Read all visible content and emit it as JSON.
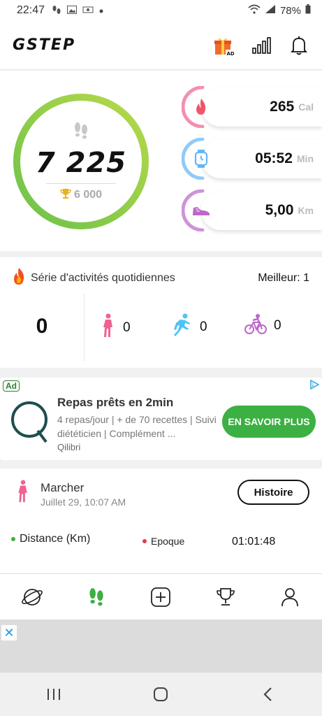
{
  "status_bar": {
    "time": "22:47",
    "battery": "78%"
  },
  "app": {
    "logo": "GSTEP"
  },
  "header_icons": [
    "gift-ad-icon",
    "bar-chart-icon",
    "bell-icon"
  ],
  "steps": {
    "count": "7 225",
    "goal": "6 000",
    "progress": 1.0
  },
  "metrics": [
    {
      "name": "calories",
      "value": "265",
      "unit": "Cal",
      "icon": "flame-icon",
      "color": "#f06292"
    },
    {
      "name": "duration",
      "value": "05:52",
      "unit": "Min",
      "icon": "watch-icon",
      "color": "#64b5f6"
    },
    {
      "name": "distance",
      "value": "5,00",
      "unit": "Km",
      "icon": "shoe-icon",
      "color": "#ba68c8"
    }
  ],
  "streak": {
    "title": "Série d'activités quotidiennes",
    "best": "Meilleur: 1",
    "total": "0",
    "activities": [
      {
        "icon": "walk-icon",
        "count": "0"
      },
      {
        "icon": "run-icon",
        "count": "0"
      },
      {
        "icon": "bike-icon",
        "count": "0"
      }
    ]
  },
  "ad": {
    "badge": "Ad",
    "title": "Repas prêts en 2min",
    "description": "4 repas/jour | + de 70 recettes | Suivi diététicien | Complément ...",
    "brand": "Qilibri",
    "cta": "EN SAVOIR PLUS"
  },
  "workout": {
    "type": "Marcher",
    "datetime": "Juillet 29, 10:07 AM",
    "history_button": "Histoire",
    "distance_label": "Distance (Km)",
    "epoch_label": "Epoque",
    "epoch_value": "01:01:48"
  },
  "bottom_nav": [
    "planet-icon",
    "footsteps-icon",
    "plus-square-icon",
    "trophy-icon",
    "person-icon"
  ],
  "colors": {
    "accent_green": "#3cb043",
    "ring_green": "#7bc043"
  }
}
